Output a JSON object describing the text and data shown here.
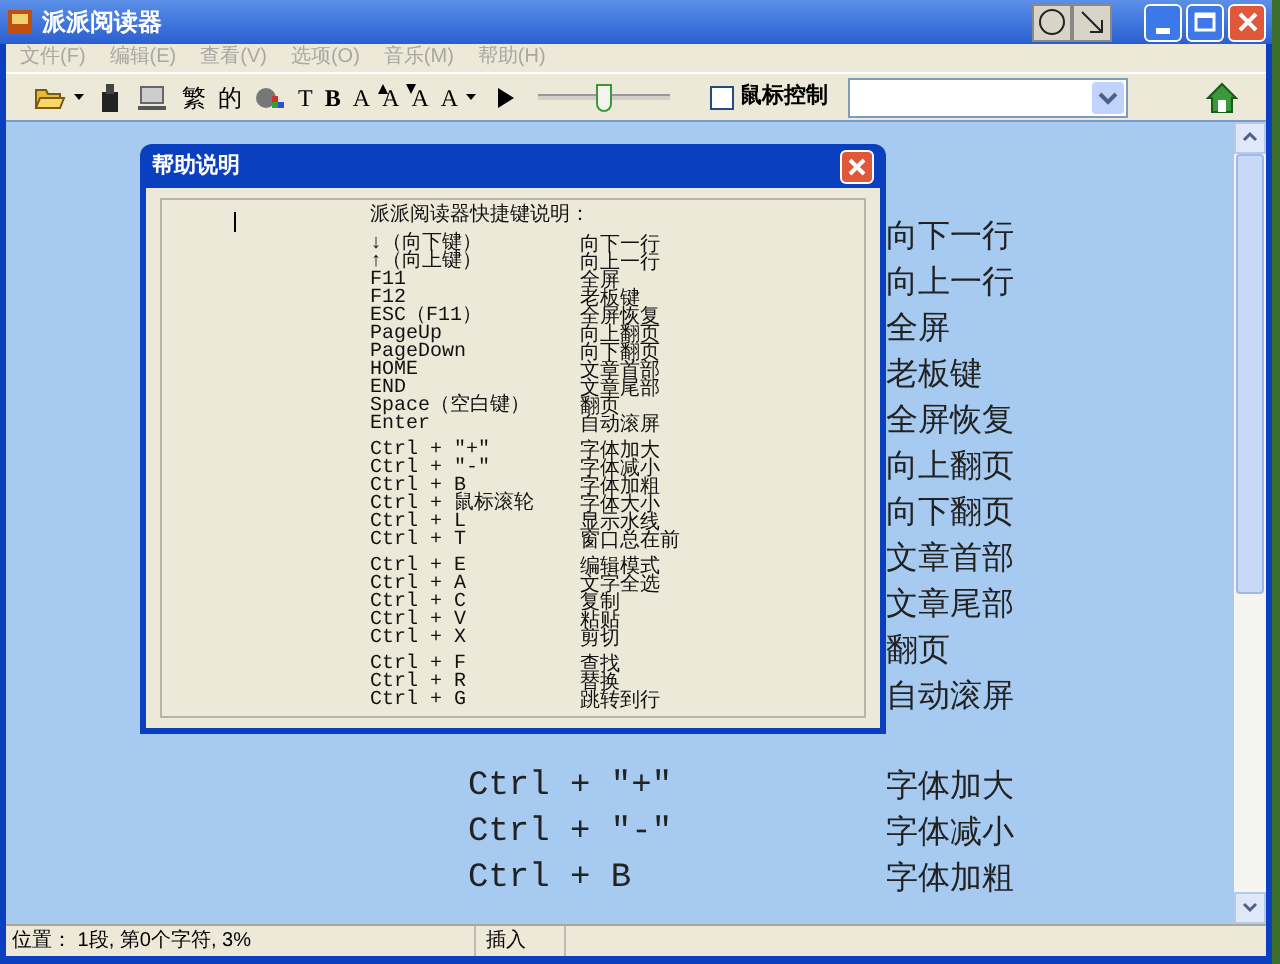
{
  "window": {
    "title": "派派阅读器"
  },
  "menu": [
    "文件(F)",
    "编辑(E)",
    "查看(V)",
    "选项(O)",
    "音乐(M)",
    "帮助(H)"
  ],
  "toolbar": {
    "glyph_buttons": [
      "繁",
      "的",
      "T",
      "B",
      "A",
      "A",
      "A",
      "A"
    ],
    "slider": {
      "level": 0.5
    },
    "mouse_control": {
      "label": "鼠标控制",
      "checked": false
    }
  },
  "background": {
    "groups": [
      [
        {
          "action": "向下一行"
        },
        {
          "action": "向上一行"
        },
        {
          "action": "全屏"
        },
        {
          "action": "老板键"
        },
        {
          "action": "全屏恢复"
        },
        {
          "action": "向上翻页"
        },
        {
          "action": "向下翻页"
        },
        {
          "action": "文章首部"
        },
        {
          "action": "文章尾部"
        },
        {
          "action": "翻页"
        },
        {
          "action": "自动滚屏"
        }
      ],
      [
        {
          "key": "Ctrl + ″+″",
          "action": "字体加大"
        },
        {
          "key": "Ctrl + ″-″",
          "action": "字体减小"
        },
        {
          "key": "Ctrl + B",
          "action": "字体加粗"
        }
      ]
    ]
  },
  "dialog": {
    "title": "帮助说明",
    "heading": "派派阅读器快捷键说明：",
    "groups": [
      [
        {
          "key": "↓（向下键）",
          "action": "向下一行"
        },
        {
          "key": "↑（向上键）",
          "action": "向上一行"
        },
        {
          "key": "F11",
          "action": "全屏"
        },
        {
          "key": "F12",
          "action": "老板键"
        },
        {
          "key": "ESC（F11）",
          "action": "全屏恢复"
        },
        {
          "key": "PageUp",
          "action": "向上翻页"
        },
        {
          "key": "PageDown",
          "action": "向下翻页"
        },
        {
          "key": "HOME",
          "action": "文章首部"
        },
        {
          "key": "END",
          "action": "文章尾部"
        },
        {
          "key": "Space（空白键）",
          "action": "翻页"
        },
        {
          "key": "Enter",
          "action": "自动滚屏"
        }
      ],
      [
        {
          "key": "Ctrl + \"+\"",
          "action": "字体加大"
        },
        {
          "key": "Ctrl + \"-\"",
          "action": "字体减小"
        },
        {
          "key": "Ctrl + B",
          "action": "字体加粗"
        },
        {
          "key": "Ctrl + 鼠标滚轮",
          "action": "字体大小"
        },
        {
          "key": "Ctrl + L",
          "action": "显示水线"
        },
        {
          "key": "Ctrl + T",
          "action": "窗口总在前"
        }
      ],
      [
        {
          "key": "Ctrl + E",
          "action": "编辑模式"
        },
        {
          "key": "Ctrl + A",
          "action": "文字全选"
        },
        {
          "key": "Ctrl + C",
          "action": "复制"
        },
        {
          "key": "Ctrl + V",
          "action": "粘贴"
        },
        {
          "key": "Ctrl + X",
          "action": "剪切"
        }
      ],
      [
        {
          "key": "Ctrl + F",
          "action": "查找"
        },
        {
          "key": "Ctrl + R",
          "action": "替换"
        },
        {
          "key": "Ctrl + G",
          "action": "跳转到行"
        }
      ]
    ]
  },
  "status_bar": {
    "position": "位置： 1段, 第0个字符,  3%",
    "mode": "插入"
  }
}
